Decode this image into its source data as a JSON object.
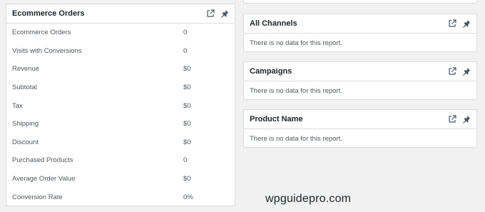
{
  "ecommerce": {
    "title": "Ecommerce Orders",
    "rows": [
      {
        "label": "Ecommerce Orders",
        "value": "0"
      },
      {
        "label": "Visits with Conversions",
        "value": "0"
      },
      {
        "label": "Revenue",
        "value": "$0"
      },
      {
        "label": "Subtotal",
        "value": "$0"
      },
      {
        "label": "Tax",
        "value": "$0"
      },
      {
        "label": "Shipping",
        "value": "$0"
      },
      {
        "label": "Discount",
        "value": "$0"
      },
      {
        "label": "Purchased Products",
        "value": "0"
      },
      {
        "label": "Average Order Value",
        "value": "$0"
      },
      {
        "label": "Conversion Rate",
        "value": "0%"
      }
    ]
  },
  "channels": {
    "title": "All Channels",
    "message": "There is no data for this report."
  },
  "campaigns": {
    "title": "Campaigns",
    "message": "There is no data for this report."
  },
  "product": {
    "title": "Product Name",
    "message": "There is no data for this report."
  },
  "watermark": "wpguidepro.com",
  "icons": {
    "external": "external-link-icon",
    "pin": "pin-icon"
  }
}
